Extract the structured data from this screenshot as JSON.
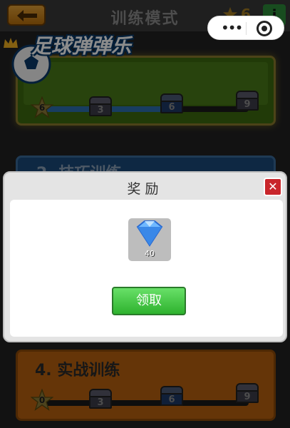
{
  "header": {
    "title": "训练模式",
    "star_count": "6",
    "info_label": "i",
    "back_icon": "back-arrow-icon",
    "capsule_more": "•••"
  },
  "logo": {
    "text": "足球弹弹乐"
  },
  "levels": [
    {
      "name": "",
      "stars": "6",
      "progress": 0.66,
      "milestones": [
        "3",
        "6",
        "9"
      ]
    },
    {
      "name": "2. 技巧训练"
    },
    {
      "name": "4. 实战训练",
      "stars": "0",
      "progress": 0,
      "milestones": [
        "3",
        "6",
        "9"
      ]
    }
  ],
  "modal": {
    "title": "奖励",
    "reward_qty": "40",
    "reward_icon": "diamond-icon",
    "claim_label": "领取",
    "close_label": "✕"
  },
  "colors": {
    "claim_green": "#2eb22e",
    "close_red": "#c9262b",
    "back_orange": "#e2a036",
    "progress_blue": "#2d6fb0"
  }
}
